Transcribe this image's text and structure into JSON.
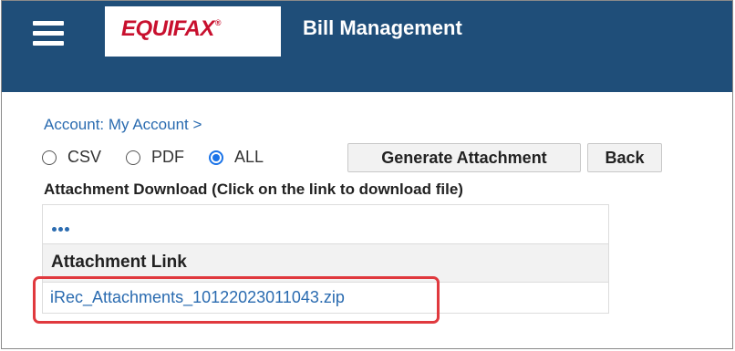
{
  "header": {
    "menu_icon": "hamburger-menu-icon",
    "logo_text": "EQUIFAX",
    "logo_reg": "®",
    "title": "Bill Management",
    "bg_color": "#1f4e79",
    "logo_color": "#c8102e"
  },
  "breadcrumb": {
    "text": "Account: My Account >"
  },
  "format_options": [
    {
      "label": "CSV",
      "selected": false
    },
    {
      "label": "PDF",
      "selected": false
    },
    {
      "label": "ALL",
      "selected": true
    }
  ],
  "buttons": {
    "generate": "Generate Attachment",
    "back": "Back"
  },
  "download_section": {
    "title": "Attachment Download (Click on the link to download file)",
    "more_icon": "more-dots-icon",
    "column_header": "Attachment Link",
    "rows": [
      {
        "link": "iRec_Attachments_10122023011043.zip"
      }
    ],
    "highlight_color": "#e0393e"
  }
}
